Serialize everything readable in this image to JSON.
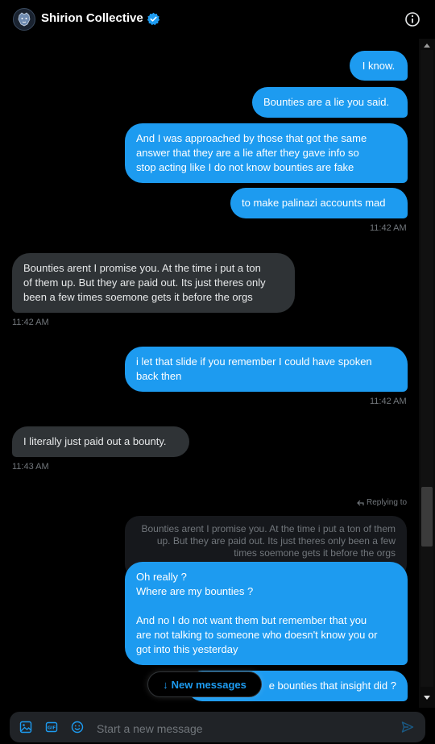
{
  "header": {
    "title": "Shirion Collective",
    "verified": true
  },
  "messages": [
    {
      "from": "me",
      "text": "I know."
    },
    {
      "from": "me",
      "text": "Bounties are a lie you said."
    },
    {
      "from": "me",
      "text": "And I was approached by those that got the same\nanswer that they are a lie after they gave info so\nstop acting like I do not know bounties are fake"
    },
    {
      "from": "me",
      "text": "to make palinazi accounts mad",
      "time": "11:42 AM"
    },
    {
      "from": "them",
      "text": "Bounties arent I promise you. At the time i put a ton\nof them up. But they are paid out. Its just theres only\nbeen a few times soemone gets it before the orgs",
      "time": "11:42 AM"
    },
    {
      "from": "me",
      "text": "i let that slide if you remember I could have spoken\nback then",
      "time": "11:42 AM"
    },
    {
      "from": "them",
      "text": "I literally just paid out a bounty.",
      "time": "11:43 AM"
    },
    {
      "from": "me",
      "text": "Oh really ?\nWhere are my bounties ?\n\nAnd no I do not want them but remember that you\nare not talking to someone who doesn't know you or\ngot into this yesterday"
    },
    {
      "from": "me",
      "text": "e bounties that insight did ?"
    }
  ],
  "reply": {
    "label": "Replying to",
    "quoted_text": "Bounties arent I promise you. At the time i put a ton of them\nup. But they are paid out. Its just theres only been a few\ntimes soemone gets it before the orgs"
  },
  "new_messages_label": "New messages",
  "composer": {
    "placeholder": "Start a new message"
  },
  "icons": {
    "avatar": "lion-logo-icon",
    "verified": "verified-badge-icon",
    "info": "info-icon",
    "media": "image-icon",
    "gif": "gif-icon",
    "emoji": "emoji-icon",
    "send": "send-icon",
    "new_messages_arrow": "arrow-down-icon"
  },
  "colors": {
    "accent": "#1d9bf0",
    "background": "#000000",
    "incoming_bubble": "#2f3336",
    "muted_text": "#71767b"
  }
}
